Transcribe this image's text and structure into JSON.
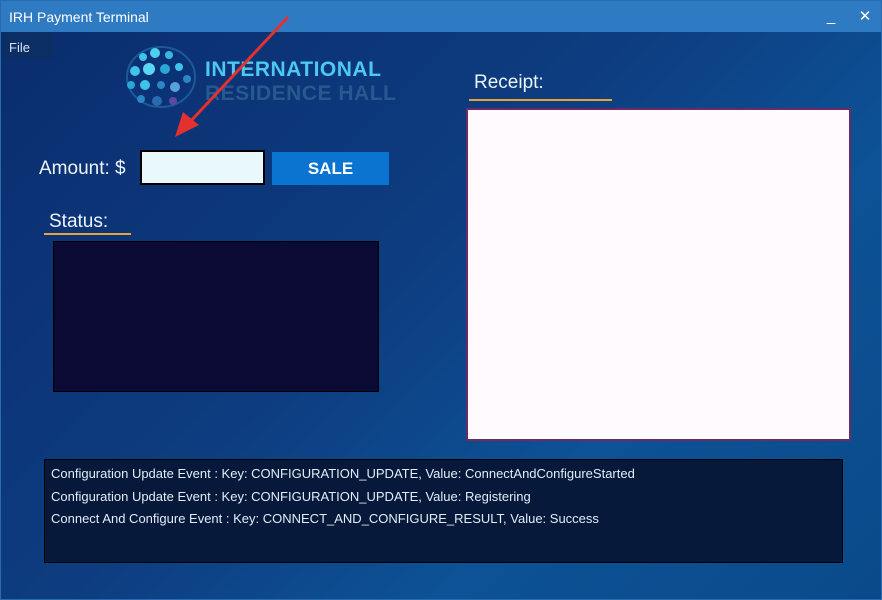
{
  "window": {
    "title": "IRH Payment Terminal",
    "minimize_label": "_",
    "close_label": "✕"
  },
  "menu": {
    "file": "File"
  },
  "logo": {
    "line1": "INTERNATIONAL",
    "line2": "RESIDENCE HALL"
  },
  "payment": {
    "amount_label": "Amount: $",
    "amount_value": "",
    "sale_label": "SALE"
  },
  "status": {
    "heading": "Status:"
  },
  "receipt": {
    "heading": "Receipt:"
  },
  "log": {
    "lines": [
      "Configuration Update Event : Key: CONFIGURATION_UPDATE, Value: ConnectAndConfigureStarted",
      "Configuration Update Event : Key: CONFIGURATION_UPDATE, Value: Registering",
      "Connect And Configure Event : Key: CONNECT_AND_CONFIGURE_RESULT, Value: Success"
    ]
  },
  "colors": {
    "titlebar": "#2f7bc3",
    "accent_underline": "#e8a23a",
    "sale_button": "#0a74d0",
    "annotation_arrow": "#e53030"
  },
  "annotation": {
    "arrow_icon": "red-arrow-icon"
  }
}
